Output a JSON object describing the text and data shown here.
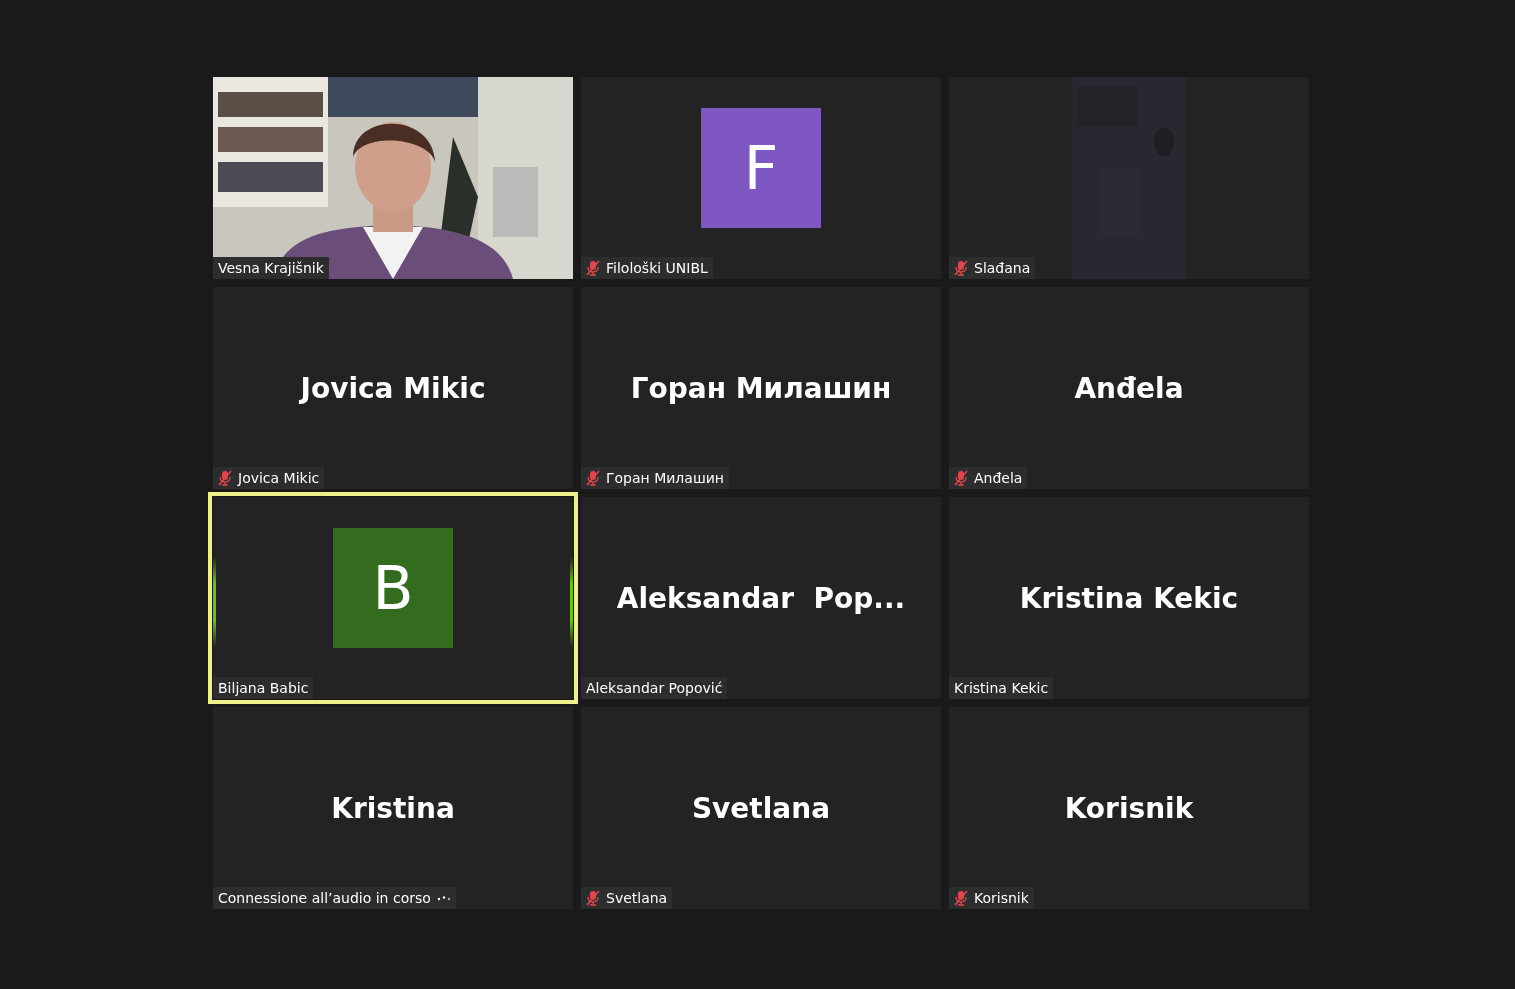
{
  "tiles": [
    {
      "kind": "camera",
      "label": "Vesna Krajišnik",
      "muted": false,
      "speaking": false
    },
    {
      "kind": "avatar",
      "letter": "F",
      "color": "#7e57c2",
      "label": "Filološki UNIBL",
      "muted": true,
      "speaking": false
    },
    {
      "kind": "dim_camera",
      "label": "Slađana",
      "muted": true,
      "speaking": false
    },
    {
      "kind": "name",
      "display_name": "Jovica Mikic",
      "label": "Jovica Mikic",
      "muted": true,
      "speaking": false
    },
    {
      "kind": "name",
      "display_name": "Горан Милашин",
      "label": "Горан Милашин",
      "muted": true,
      "speaking": false
    },
    {
      "kind": "name",
      "display_name": "Anđela",
      "label": "Anđela",
      "muted": true,
      "speaking": false
    },
    {
      "kind": "avatar",
      "letter": "B",
      "color": "#336b1f",
      "label": "Biljana Babic",
      "muted": false,
      "speaking": true
    },
    {
      "kind": "name",
      "display_name": "Aleksandar  Pop...",
      "label": "Aleksandar Popović",
      "muted": false,
      "speaking": false
    },
    {
      "kind": "name",
      "display_name": "Kristina Kekic",
      "label": "Kristina Kekic",
      "muted": false,
      "speaking": false
    },
    {
      "kind": "name",
      "display_name": "Kristina",
      "label": "Connessione all’audio in corso",
      "connecting": true,
      "muted": false,
      "speaking": false
    },
    {
      "kind": "name",
      "display_name": "Svetlana",
      "label": "Svetlana",
      "muted": true,
      "speaking": false
    },
    {
      "kind": "name",
      "display_name": "Korisnik",
      "label": "Korisnik",
      "muted": true,
      "speaking": false
    }
  ]
}
